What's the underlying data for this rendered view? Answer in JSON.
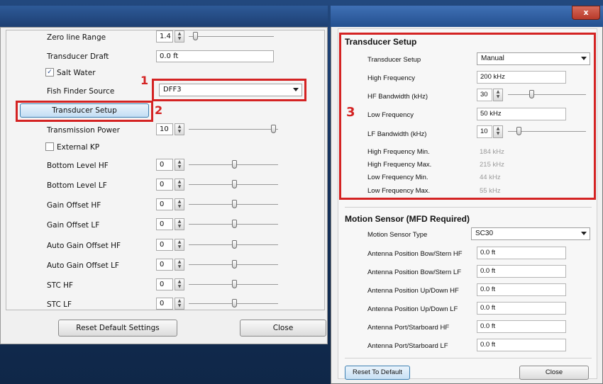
{
  "left_dialog": {
    "rows": [
      {
        "label": "Zero line Range",
        "value": "1.4"
      },
      {
        "label": "Transducer Draft",
        "value": "0.0 ft"
      },
      {
        "label": "Salt Water"
      },
      {
        "label": "Fish Finder Source",
        "value": "DFF3"
      },
      {
        "label": "Transducer Setup"
      },
      {
        "label": "Transmission Power",
        "value": "10"
      },
      {
        "label": "External KP"
      },
      {
        "label": "Bottom Level HF",
        "value": "0"
      },
      {
        "label": "Bottom Level LF",
        "value": "0"
      },
      {
        "label": "Gain Offset HF",
        "value": "0"
      },
      {
        "label": "Gain Offset LF",
        "value": "0"
      },
      {
        "label": "Auto Gain Offset HF",
        "value": "0"
      },
      {
        "label": "Auto Gain Offset LF",
        "value": "0"
      },
      {
        "label": "STC HF",
        "value": "0"
      },
      {
        "label": "STC LF",
        "value": "0"
      }
    ],
    "reset_label": "Reset Default Settings",
    "close_label": "Close"
  },
  "annotations": {
    "n1": "1",
    "n2": "2",
    "n3": "3"
  },
  "right_dialog": {
    "close_x": "x",
    "transducer_header": "Transducer Setup",
    "transducer": [
      {
        "label": "Transducer Setup",
        "value": "Manual"
      },
      {
        "label": "High Frequency",
        "value": "200 kHz"
      },
      {
        "label": "HF Bandwidth (kHz)",
        "value": "30"
      },
      {
        "label": "Low Frequency",
        "value": "50 kHz"
      },
      {
        "label": "LF Bandwidth (kHz)",
        "value": "10"
      },
      {
        "label": "High Frequency Min.",
        "value": "184 kHz"
      },
      {
        "label": "High Frequency Max.",
        "value": "215 kHz"
      },
      {
        "label": "Low Frequency Min.",
        "value": "44 kHz"
      },
      {
        "label": "Low Frequency Max.",
        "value": "55 kHz"
      }
    ],
    "motion_header": "Motion Sensor (MFD Required)",
    "motion": [
      {
        "label": "Motion Sensor Type",
        "value": "SC30"
      },
      {
        "label": "Antenna Position Bow/Stern HF",
        "value": "0.0 ft"
      },
      {
        "label": "Antenna Position Bow/Stern LF",
        "value": "0.0 ft"
      },
      {
        "label": "Antenna Position Up/Down HF",
        "value": "0.0 ft"
      },
      {
        "label": "Antenna Position Up/Down LF",
        "value": "0.0 ft"
      },
      {
        "label": "Antenna Port/Starboard HF",
        "value": "0.0 ft"
      },
      {
        "label": "Antenna Port/Starboard LF",
        "value": "0.0 ft"
      }
    ],
    "reset_label": "Reset To Default",
    "close_label": "Close"
  },
  "colors": {
    "annotation_red": "#d42323",
    "titlebar_blue": "#2e5a98"
  }
}
